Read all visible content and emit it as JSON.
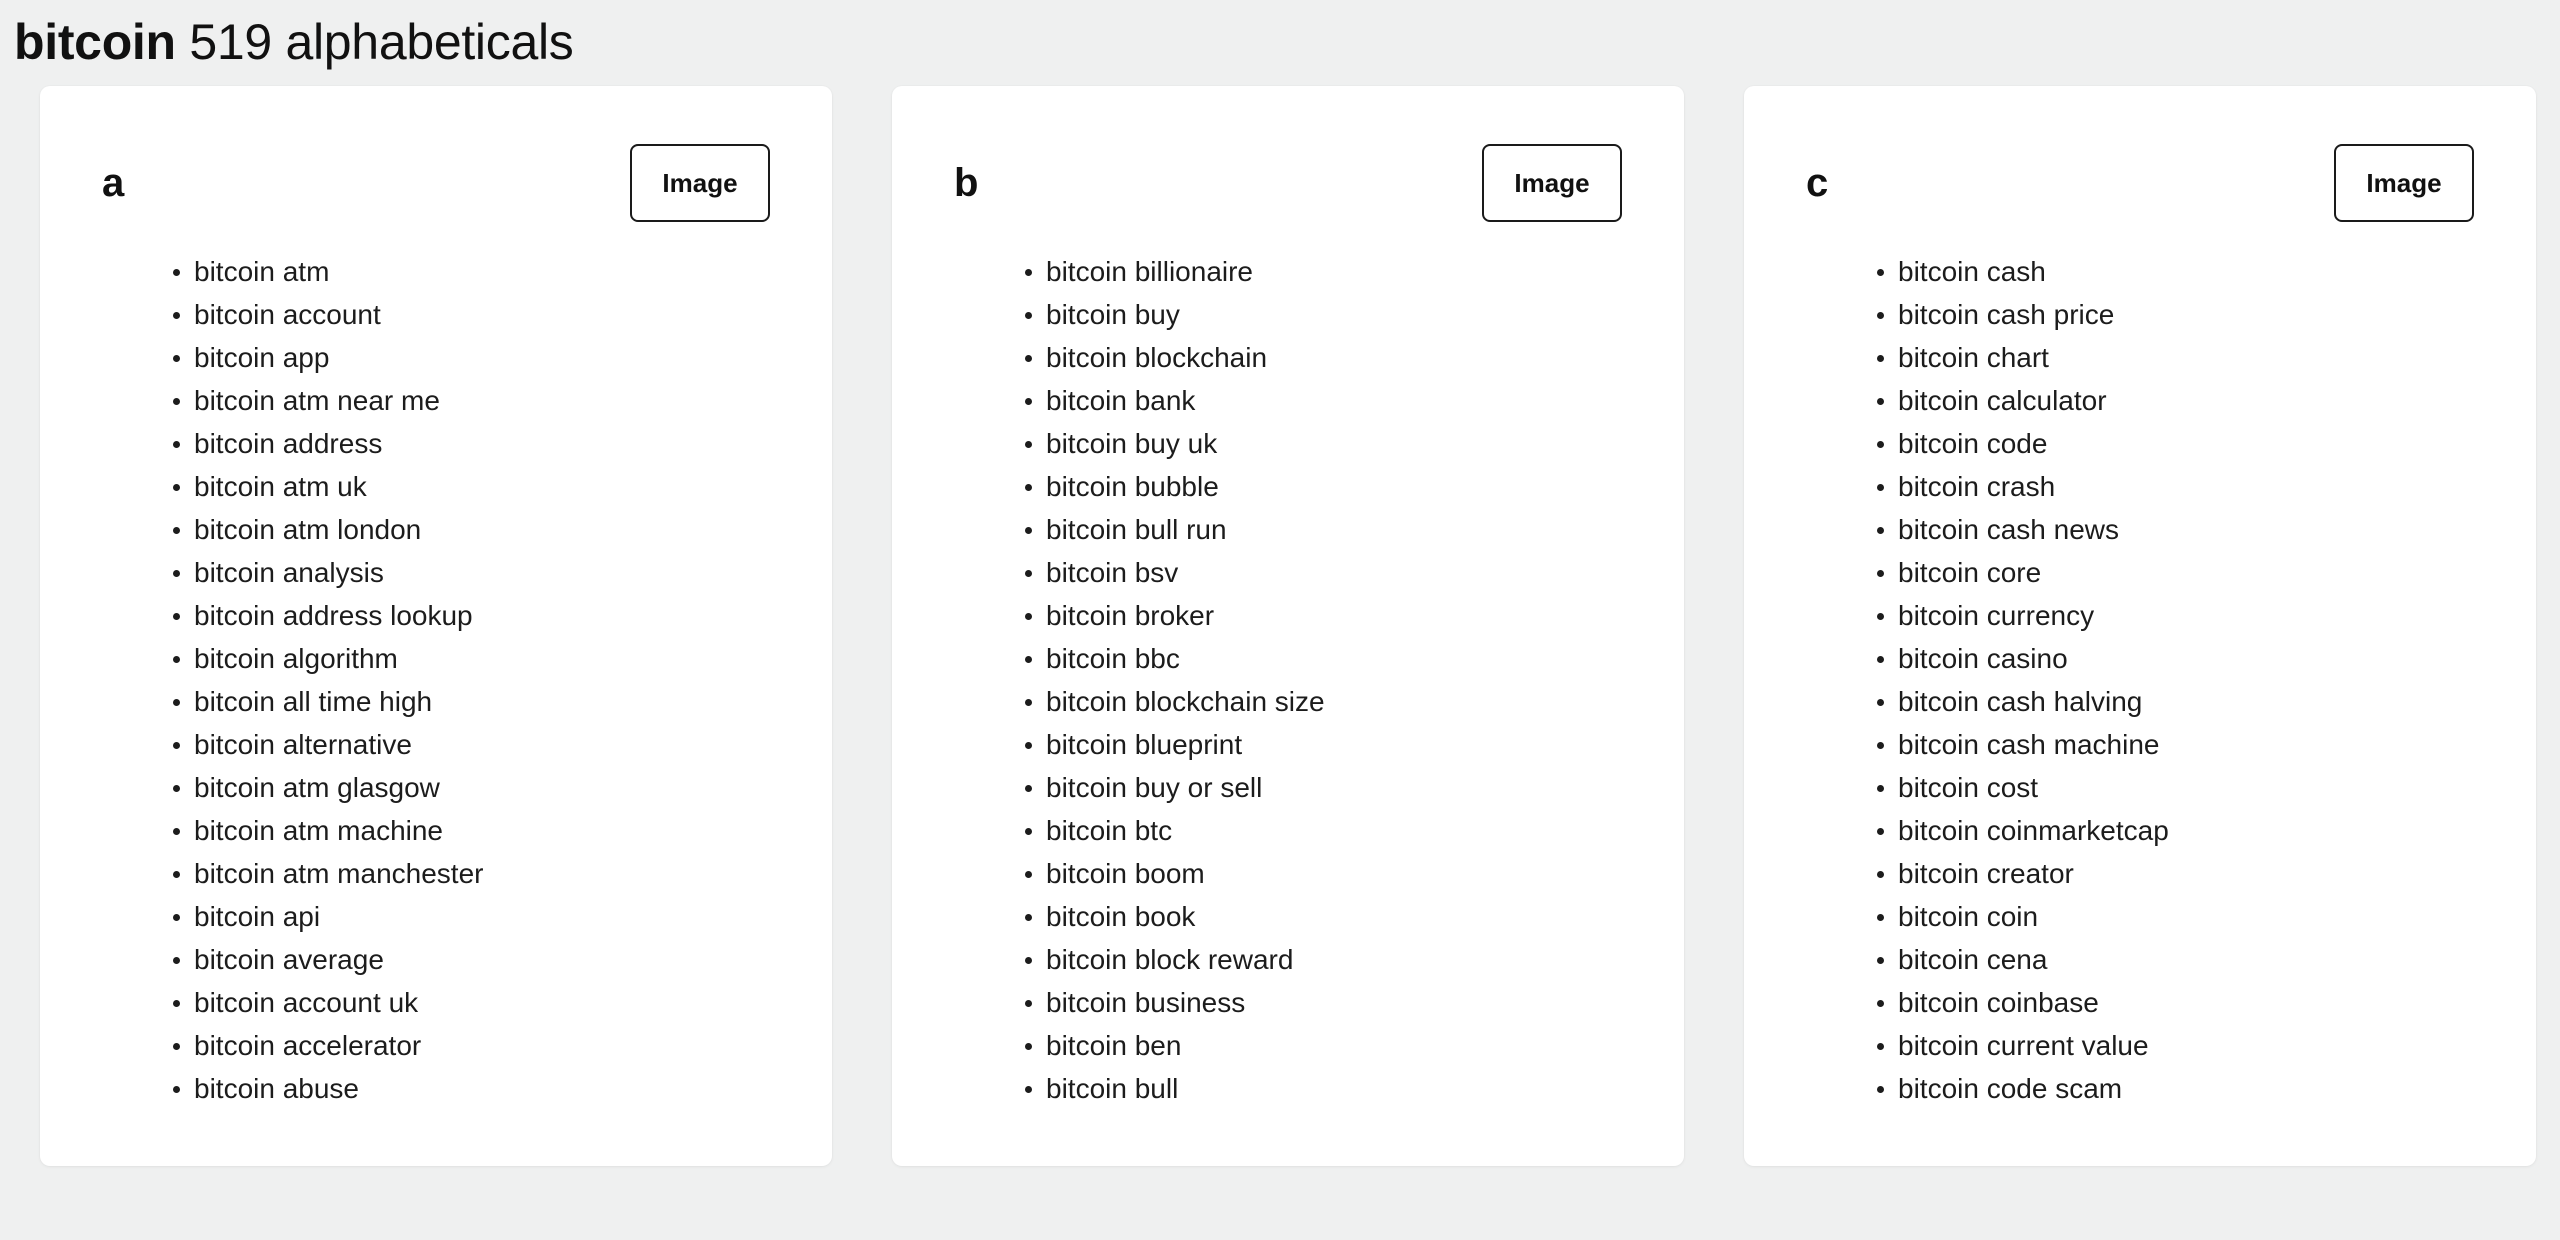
{
  "header": {
    "keyword": "bitcoin",
    "rest": " 519 alphabeticals"
  },
  "image_button_label": "Image",
  "cards": [
    {
      "letter": "a",
      "image_button": "Image",
      "items": [
        "bitcoin atm",
        "bitcoin account",
        "bitcoin app",
        "bitcoin atm near me",
        "bitcoin address",
        "bitcoin atm uk",
        "bitcoin atm london",
        "bitcoin analysis",
        "bitcoin address lookup",
        "bitcoin algorithm",
        "bitcoin all time high",
        "bitcoin alternative",
        "bitcoin atm glasgow",
        "bitcoin atm machine",
        "bitcoin atm manchester",
        "bitcoin api",
        "bitcoin average",
        "bitcoin account uk",
        "bitcoin accelerator",
        "bitcoin abuse"
      ]
    },
    {
      "letter": "b",
      "image_button": "Image",
      "items": [
        "bitcoin billionaire",
        "bitcoin buy",
        "bitcoin blockchain",
        "bitcoin bank",
        "bitcoin buy uk",
        "bitcoin bubble",
        "bitcoin bull run",
        "bitcoin bsv",
        "bitcoin broker",
        "bitcoin bbc",
        "bitcoin blockchain size",
        "bitcoin blueprint",
        "bitcoin buy or sell",
        "bitcoin btc",
        "bitcoin boom",
        "bitcoin book",
        "bitcoin block reward",
        "bitcoin business",
        "bitcoin ben",
        "bitcoin bull"
      ]
    },
    {
      "letter": "c",
      "image_button": "Image",
      "items": [
        "bitcoin cash",
        "bitcoin cash price",
        "bitcoin chart",
        "bitcoin calculator",
        "bitcoin code",
        "bitcoin crash",
        "bitcoin cash news",
        "bitcoin core",
        "bitcoin currency",
        "bitcoin casino",
        "bitcoin cash halving",
        "bitcoin cash machine",
        "bitcoin cost",
        "bitcoin coinmarketcap",
        "bitcoin creator",
        "bitcoin coin",
        "bitcoin cena",
        "bitcoin coinbase",
        "bitcoin current value",
        "bitcoin code scam"
      ]
    }
  ]
}
